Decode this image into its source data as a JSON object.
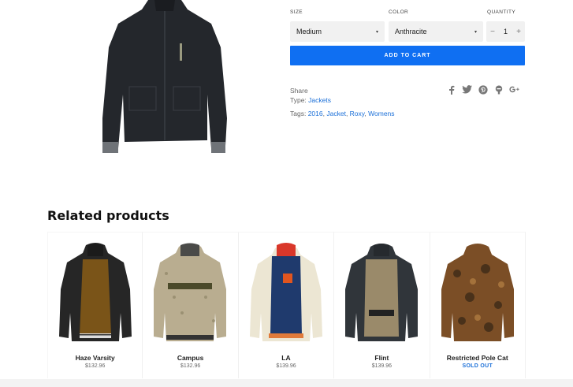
{
  "options": {
    "size_label": "SIZE",
    "size_value": "Medium",
    "color_label": "COLOR",
    "color_value": "Anthracite",
    "quantity_label": "QUANTITY",
    "quantity_value": "1",
    "minus": "−",
    "plus": "+"
  },
  "cart": {
    "add_label": "ADD TO CART"
  },
  "share": {
    "label": "Share",
    "icons": [
      "facebook-icon",
      "twitter-icon",
      "pinterest-icon",
      "fancy-icon",
      "google-plus-icon"
    ]
  },
  "meta": {
    "type_label": "Type:",
    "type_value": "Jackets",
    "tags_label": "Tags:",
    "tags": [
      "2016",
      "Jacket",
      "Roxy",
      "Womens"
    ]
  },
  "related": {
    "title": "Related products",
    "products": [
      {
        "name": "Haze Varsity",
        "price": "$132.96"
      },
      {
        "name": "Campus",
        "price": "$132.96"
      },
      {
        "name": "LA",
        "price": "$139.96"
      },
      {
        "name": "Flint",
        "price": "$139.96"
      },
      {
        "name": "Restricted Pole Cat",
        "price": "SOLD OUT"
      }
    ]
  },
  "colors": {
    "accent": "#0f6ff2",
    "link": "#1a6fd8",
    "field_bg": "#f1f1f1"
  }
}
